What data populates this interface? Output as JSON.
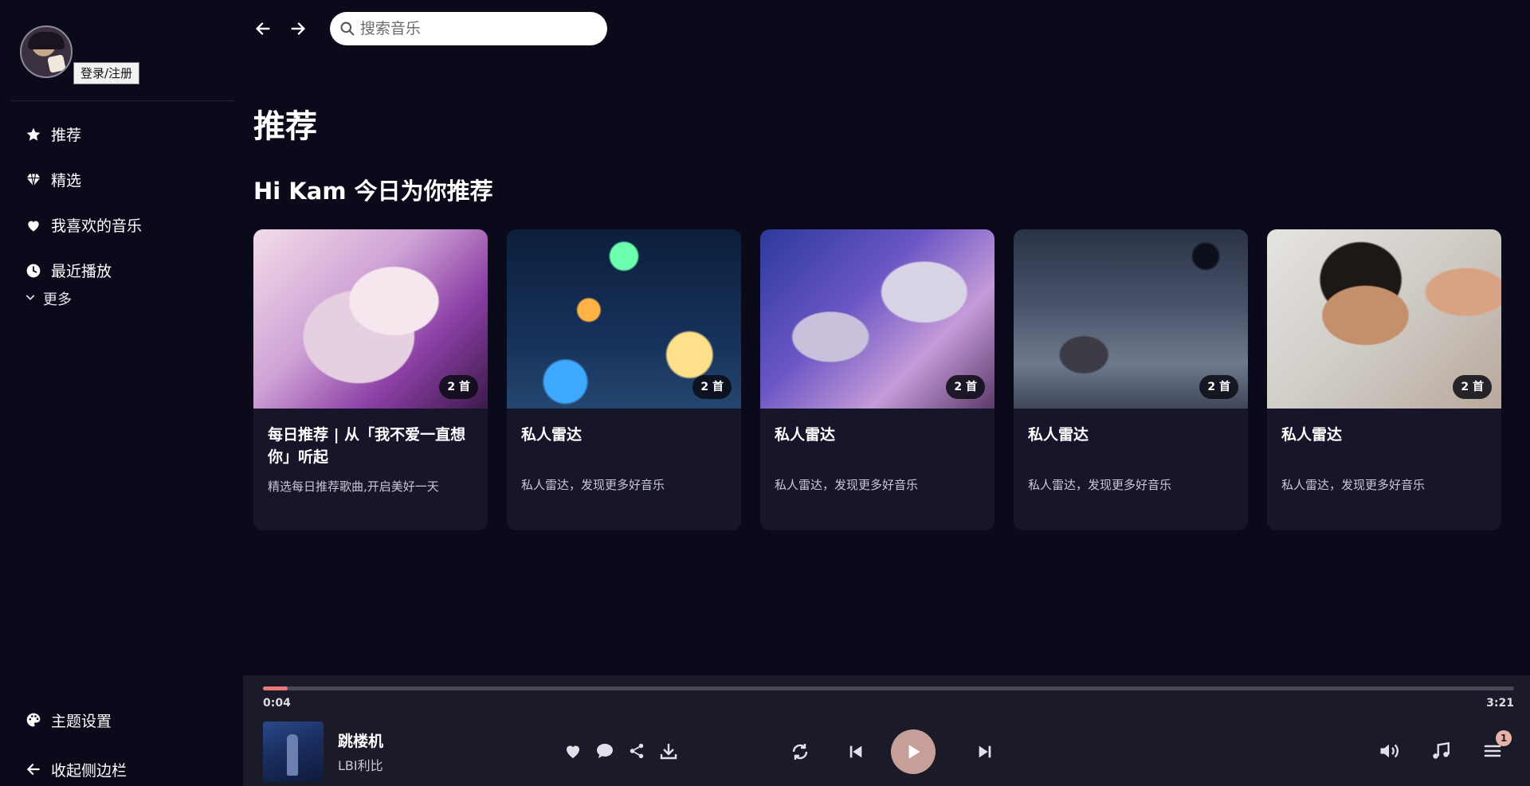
{
  "sidebar": {
    "login_tooltip": "登录/注册",
    "nav": [
      {
        "label": "推荐",
        "icon": "star-icon"
      },
      {
        "label": "精选",
        "icon": "diamond-icon"
      },
      {
        "label": "我喜欢的音乐",
        "icon": "heart-icon"
      },
      {
        "label": "最近播放",
        "icon": "clock-icon"
      }
    ],
    "more_label": "更多",
    "theme_label": "主题设置",
    "collapse_label": "收起侧边栏"
  },
  "search": {
    "placeholder": "搜索音乐"
  },
  "main": {
    "page_title": "推荐",
    "section_title": "Hi Kam 今日为你推荐",
    "cards": [
      {
        "title": "每日推荐 | 从「我不爱一直想你」听起",
        "desc": "精选每日推荐歌曲,开启美好一天",
        "count": "2 首"
      },
      {
        "title": "私人雷达",
        "desc": "私人雷达，发现更多好音乐",
        "count": "2 首"
      },
      {
        "title": "私人雷达",
        "desc": "私人雷达，发现更多好音乐",
        "count": "2 首"
      },
      {
        "title": "私人雷达",
        "desc": "私人雷达，发现更多好音乐",
        "count": "2 首"
      },
      {
        "title": "私人雷达",
        "desc": "私人雷达，发现更多好音乐",
        "count": "2 首"
      }
    ]
  },
  "player": {
    "current_time": "0:04",
    "total_time": "3:21",
    "progress": 0.02,
    "song_title": "跳楼机",
    "artist": "LBI利比",
    "queue_count": "1",
    "accent_color": "#e97878"
  }
}
